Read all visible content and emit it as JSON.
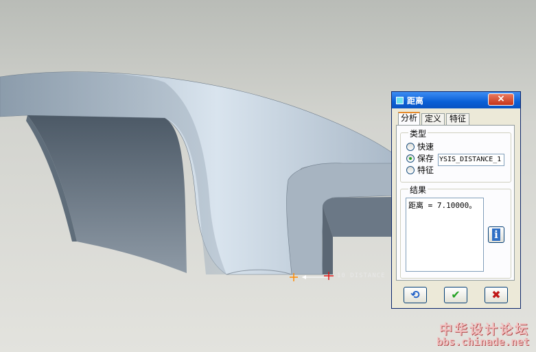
{
  "viewport": {
    "dimension_label": "10 DISTANCE"
  },
  "dialog": {
    "title": "距离",
    "close_glyph": "×",
    "tabs": [
      {
        "label": "分析",
        "active": true
      },
      {
        "label": "定义",
        "active": false
      },
      {
        "label": "特征",
        "active": false
      }
    ],
    "type_group": {
      "legend": "类型",
      "options": [
        {
          "label": "快速",
          "selected": false
        },
        {
          "label": "保存",
          "selected": true
        },
        {
          "label": "特征",
          "selected": false
        }
      ],
      "save_name_value": "YSIS_DISTANCE_1"
    },
    "results_group": {
      "legend": "结果",
      "result_text": "距离 = 7.10000。"
    },
    "info_icon": "info-icon",
    "buttons": {
      "repeat_icon": "repeat-icon",
      "ok_icon": "checkmark-icon",
      "cancel_icon": "x-icon",
      "repeat_glyph": "⟲",
      "ok_glyph": "✔",
      "cancel_glyph": "✖"
    },
    "colors": {
      "title_bar": "#0a5fd6",
      "ok_green": "#21a121",
      "cancel_red": "#c01818"
    }
  },
  "watermark": {
    "chinese": "中华设计论坛",
    "url": "bbs.chinade.net"
  }
}
